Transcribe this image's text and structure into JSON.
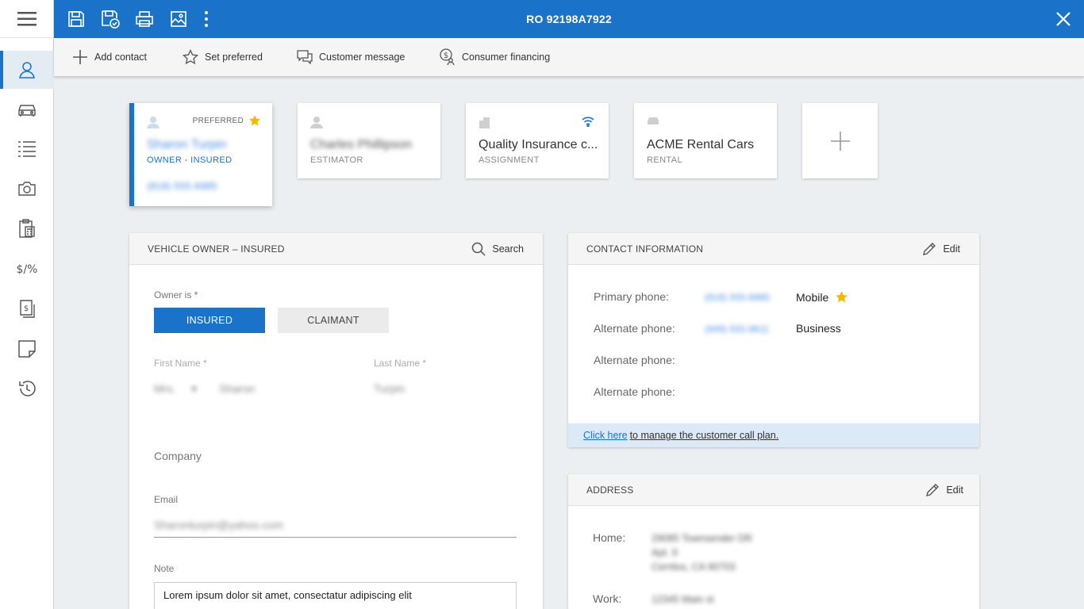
{
  "header": {
    "title": "RO 92198A7922",
    "icons": [
      "save-icon",
      "save-check-icon",
      "print-icon",
      "image-icon",
      "more-vert-icon"
    ],
    "close_icon": "close-icon"
  },
  "toolbar": {
    "add_contact": "Add contact",
    "set_preferred": "Set preferred",
    "customer_message": "Customer message",
    "consumer_financing": "Consumer financing"
  },
  "sidebar": {
    "items": [
      {
        "icon": "person-icon",
        "active": true
      },
      {
        "icon": "car-icon"
      },
      {
        "icon": "list-icon"
      },
      {
        "icon": "camera-icon"
      },
      {
        "icon": "clipboard-calc-icon"
      },
      {
        "icon": "dollar-percent-icon",
        "glyph": "$/%"
      },
      {
        "icon": "invoice-dollar-icon"
      },
      {
        "icon": "note-icon"
      },
      {
        "icon": "history-icon"
      }
    ]
  },
  "contacts": {
    "cards": [
      {
        "name": "Sharon Turpin",
        "role": "OWNER - INSURED",
        "phone": "(818) 555-6985",
        "preferred_label": "PREFERRED"
      },
      {
        "name": "Charles Phillipson",
        "role": "ESTIMATOR"
      },
      {
        "name": "Quality Insurance c...",
        "role": "ASSIGNMENT"
      },
      {
        "name": "ACME Rental Cars",
        "role": "RENTAL"
      }
    ]
  },
  "owner_panel": {
    "title": "VEHICLE OWNER – INSURED",
    "search": "Search",
    "owner_is_label": "Owner is *",
    "insured_btn": "INSURED",
    "claimant_btn": "CLAIMANT",
    "first_name_label": "First Name *",
    "last_name_label": "Last Name *",
    "salutation": "Mrs.",
    "first_name": "Sharon",
    "last_name": "Turpin",
    "company_label": "Company",
    "email_label": "Email",
    "email": "Sharonturpin@yahoo.com",
    "note_label": "Note",
    "note": "Lorem ipsum dolor sit amet, consectatur adipiscing elit"
  },
  "contact_panel": {
    "title": "CONTACT INFORMATION",
    "edit": "Edit",
    "rows": [
      {
        "label": "Primary phone:",
        "number": "(818) 555-6985",
        "type": "Mobile",
        "preferred": true
      },
      {
        "label": "Alternate phone:",
        "number": "(949) 555-9611",
        "type": "Business"
      },
      {
        "label": "Alternate phone:",
        "number": "",
        "type": ""
      },
      {
        "label": "Alternate phone:",
        "number": "",
        "type": ""
      }
    ],
    "call_plan_link": "Click here",
    "call_plan_rest": "to manage the customer call plan."
  },
  "address_panel": {
    "title": "ADDRESS",
    "edit": "Edit",
    "home_label": "Home:",
    "home_line1": "29085 Townsender DR",
    "home_line2": "Apt. 9",
    "home_line3": "Cerritos, CA 90703",
    "work_label": "Work:",
    "work_line1": "12345 Main st"
  },
  "colors": {
    "accent": "#1a73c8",
    "star": "#f5b800",
    "link": "#4a90e2"
  }
}
